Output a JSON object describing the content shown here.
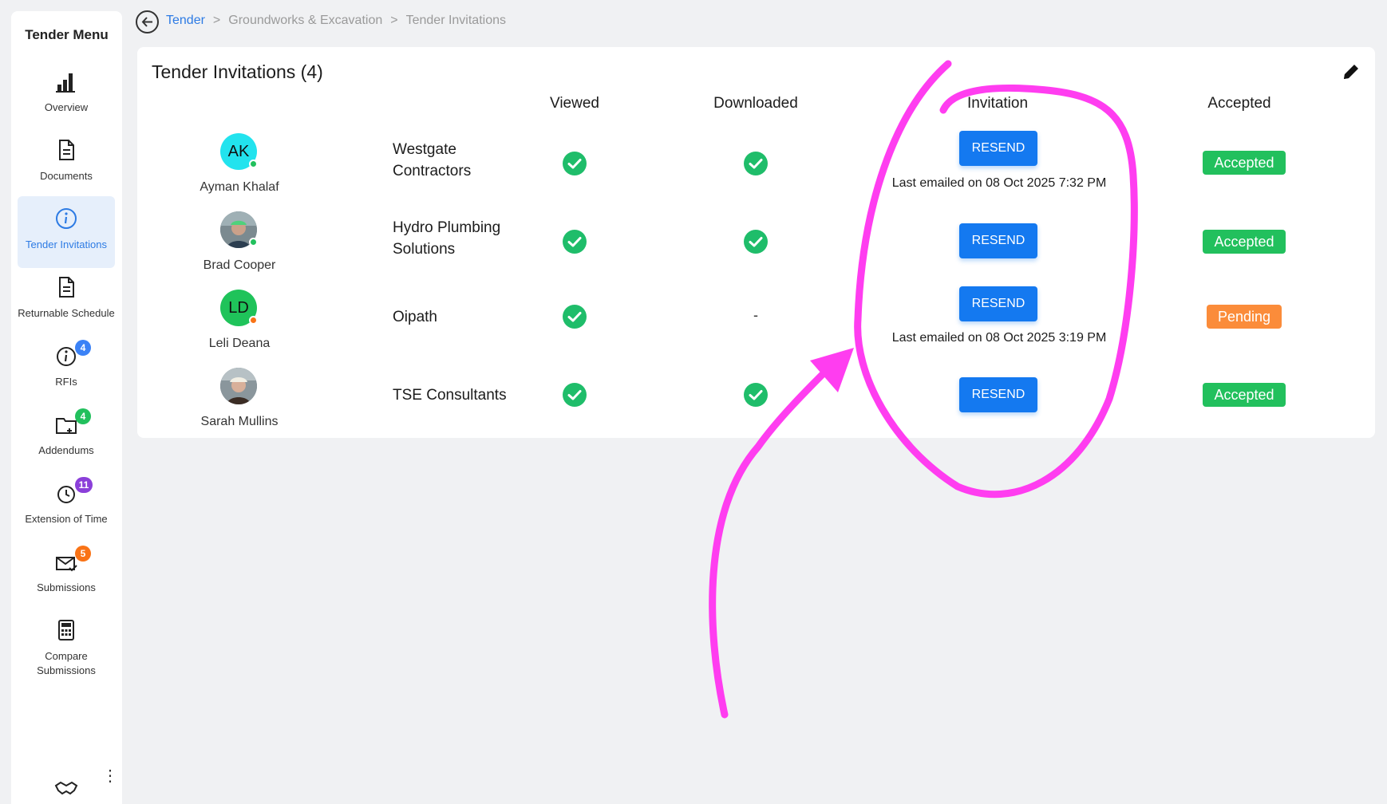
{
  "sidebar": {
    "title": "Tender Menu",
    "items": [
      {
        "label": "Overview",
        "icon": "bar-chart-icon"
      },
      {
        "label": "Documents",
        "icon": "document-icon"
      },
      {
        "label": "Tender Invitations",
        "icon": "info-icon"
      },
      {
        "label": "Returnable Schedule",
        "icon": "document-icon"
      },
      {
        "label": "RFIs",
        "icon": "info-icon",
        "badge": "4",
        "badge_color": "#3b82f6"
      },
      {
        "label": "Addendums",
        "icon": "folder-plus-icon",
        "badge": "4",
        "badge_color": "#22c05d"
      },
      {
        "label": "Extension of Time",
        "icon": "clock-icon",
        "badge": "11",
        "badge_color": "#8b3fd9"
      },
      {
        "label": "Submissions",
        "icon": "mail-check-icon",
        "badge": "5",
        "badge_color": "#f97316"
      },
      {
        "label": "Compare Submissions",
        "icon": "calculator-icon"
      }
    ],
    "more": "⋮"
  },
  "breadcrumb": {
    "items": [
      "Tender",
      "Groundworks & Excavation",
      "Tender Invitations"
    ],
    "sep": ">"
  },
  "card": {
    "title": "Tender Invitations (4)",
    "columns": {
      "viewed": "Viewed",
      "downloaded": "Downloaded",
      "invitation": "Invitation",
      "accepted": "Accepted"
    },
    "resend_label": "RESEND",
    "rows": [
      {
        "initials": "AK",
        "name": "Ayman Khalaf",
        "company": "Westgate Contractors",
        "status": "Accepted",
        "last_emailed": "Last emailed on 08 Oct 2025 7:32 PM",
        "avatar_color": "#22e3ee",
        "dot_color": "#22c05d"
      },
      {
        "initials": "",
        "name": "Brad Cooper",
        "company": "Hydro Plumbing Solutions",
        "status": "Accepted",
        "last_emailed": "",
        "avatar_color": "#6b7c86",
        "dot_color": "#22c05d"
      },
      {
        "initials": "LD",
        "name": "Leli Deana",
        "company": "Oipath",
        "status": "Pending",
        "last_emailed": "Last emailed on 08 Oct 2025 3:19 PM",
        "downloaded": "-",
        "avatar_color": "#1fc35a",
        "dot_color": "#f97316"
      },
      {
        "initials": "",
        "name": "Sarah Mullins",
        "company": "TSE Consultants",
        "status": "Accepted",
        "last_emailed": "",
        "avatar_color": "#7d8a93",
        "dot_color": ""
      }
    ]
  },
  "colors": {
    "accent": "#2d7be4",
    "resend": "#1479f0",
    "accepted": "#22c05d",
    "pending": "#fb8c3a",
    "check": "#1fbd6a",
    "annotation": "#ff3df0"
  }
}
